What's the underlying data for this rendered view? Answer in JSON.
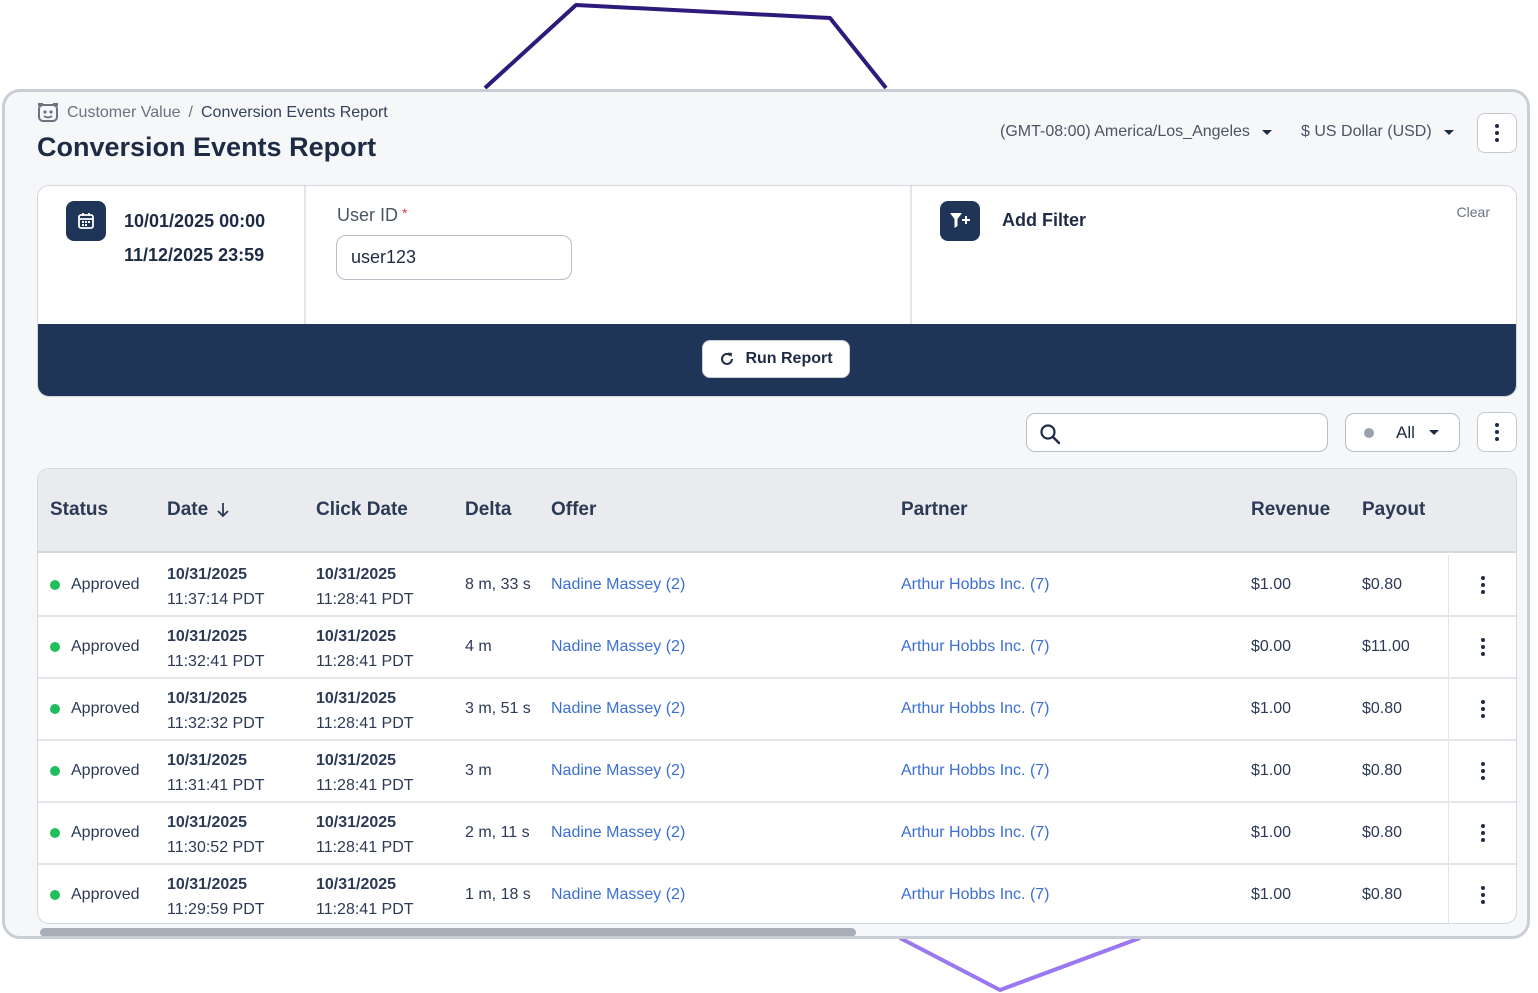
{
  "breadcrumb": {
    "parent": "Customer Value",
    "separator": "/",
    "current": "Conversion Events Report"
  },
  "page_title": "Conversion Events Report",
  "header": {
    "timezone": "(GMT-08:00) America/Los_Angeles",
    "currency": "$ US Dollar (USD)"
  },
  "filters": {
    "date_start": "10/01/2025 00:00",
    "date_end": "11/12/2025 23:59",
    "user_id_label": "User ID",
    "user_id_required": "*",
    "user_id_value": "user123",
    "add_filter_label": "Add Filter",
    "clear_label": "Clear",
    "run_report_label": "Run Report"
  },
  "table_controls": {
    "search_placeholder": "",
    "status_filter_value": "All"
  },
  "table": {
    "columns": [
      "Status",
      "Date",
      "Click Date",
      "Delta",
      "Offer",
      "Partner",
      "Revenue",
      "Payout"
    ],
    "rows": [
      {
        "status": "Approved",
        "date": "10/31/2025",
        "time": "11:37:14 PDT",
        "click_date": "10/31/2025",
        "click_time": "11:28:41 PDT",
        "delta": "8 m, 33 s",
        "offer": "Nadine Massey (2)",
        "partner": "Arthur Hobbs Inc. (7)",
        "revenue": "$1.00",
        "payout": "$0.80"
      },
      {
        "status": "Approved",
        "date": "10/31/2025",
        "time": "11:32:41 PDT",
        "click_date": "10/31/2025",
        "click_time": "11:28:41 PDT",
        "delta": "4 m",
        "offer": "Nadine Massey (2)",
        "partner": "Arthur Hobbs Inc. (7)",
        "revenue": "$0.00",
        "payout": "$11.00"
      },
      {
        "status": "Approved",
        "date": "10/31/2025",
        "time": "11:32:32 PDT",
        "click_date": "10/31/2025",
        "click_time": "11:28:41 PDT",
        "delta": "3 m, 51 s",
        "offer": "Nadine Massey (2)",
        "partner": "Arthur Hobbs Inc. (7)",
        "revenue": "$1.00",
        "payout": "$0.80"
      },
      {
        "status": "Approved",
        "date": "10/31/2025",
        "time": "11:31:41 PDT",
        "click_date": "10/31/2025",
        "click_time": "11:28:41 PDT",
        "delta": "3 m",
        "offer": "Nadine Massey (2)",
        "partner": "Arthur Hobbs Inc. (7)",
        "revenue": "$1.00",
        "payout": "$0.80"
      },
      {
        "status": "Approved",
        "date": "10/31/2025",
        "time": "11:30:52 PDT",
        "click_date": "10/31/2025",
        "click_time": "11:28:41 PDT",
        "delta": "2 m, 11 s",
        "offer": "Nadine Massey (2)",
        "partner": "Arthur Hobbs Inc. (7)",
        "revenue": "$1.00",
        "payout": "$0.80"
      },
      {
        "status": "Approved",
        "date": "10/31/2025",
        "time": "11:29:59 PDT",
        "click_date": "10/31/2025",
        "click_time": "11:28:41 PDT",
        "delta": "1 m, 18 s",
        "offer": "Nadine Massey (2)",
        "partner": "Arthur Hobbs Inc. (7)",
        "revenue": "$1.00",
        "payout": "$0.80"
      }
    ]
  },
  "colors": {
    "navy": "#1e3557",
    "status_approved": "#1ebe5d",
    "link": "#3b6fd4",
    "required": "#e53935"
  },
  "icons": [
    "app-logo-icon",
    "chevron-down-icon",
    "more-vertical-icon",
    "calendar-icon",
    "filter-add-icon",
    "refresh-icon",
    "search-icon",
    "sort-down-arrow-icon"
  ]
}
